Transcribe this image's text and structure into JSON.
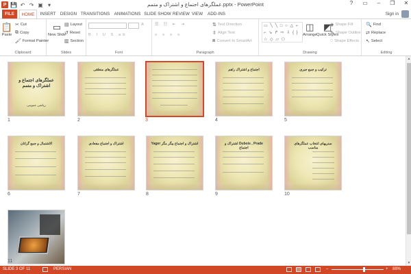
{
  "window": {
    "title": "عملگرهای اجتماع و اشتراک و متمم.pptx - PowerPoint",
    "controls": [
      "?",
      "▭",
      "–",
      "❐",
      "✕"
    ]
  },
  "qat": {
    "logo": "P",
    "save": "💾",
    "undo": "↶",
    "redo": "↷",
    "present": "▣",
    "customize": "▾"
  },
  "tabs": {
    "file": "FILE",
    "items": [
      {
        "label": "HOME",
        "active": true
      },
      {
        "label": "INSERT"
      },
      {
        "label": "DESIGN"
      },
      {
        "label": "TRANSITIONS"
      },
      {
        "label": "ANIMATIONS"
      },
      {
        "label": "SLIDE SHOW"
      },
      {
        "label": "REVIEW"
      },
      {
        "label": "VIEW"
      },
      {
        "label": "ADD-INS"
      }
    ],
    "signin": "Sign in"
  },
  "ribbon": {
    "clipboard": {
      "label": "Clipboard",
      "paste": "Paste",
      "cut": "Cut",
      "copy": "Copy",
      "format_painter": "Format Painter"
    },
    "slides": {
      "label": "Slides",
      "new_slide": "New Slide",
      "layout": "Layout",
      "reset": "Reset",
      "section": "Section"
    },
    "font": {
      "label": "Font"
    },
    "paragraph": {
      "label": "Paragraph",
      "text_direction": "Text Direction",
      "align_text": "Align Text",
      "convert": "Convert to SmartArt"
    },
    "drawing": {
      "label": "Drawing",
      "arrange": "Arrange",
      "quick_styles": "Quick Styles",
      "shape_fill": "Shape Fill",
      "shape_outline": "Shape Outline",
      "shape_effects": "Shape Effects",
      "shapes_glyphs": "▭ ╲ ╲ □ ○ △ ⌐ ⌐ ↘ ↱ ⇨ ⇩ { } ☆ ◇ ▱ ⬠"
    },
    "editing": {
      "label": "Editing",
      "find": "Find",
      "replace": "Replace",
      "select": "Select"
    }
  },
  "slides": [
    {
      "number": "1",
      "title": "عملگرهای اجتماع و اشتراک و متمم",
      "subtitle": "ریاضی عمومی"
    },
    {
      "number": "2",
      "title": "عملگرهای منطقی"
    },
    {
      "number": "3",
      "title": "",
      "selected": true
    },
    {
      "number": "4",
      "title": "اجتماع و اشتراک راهم"
    },
    {
      "number": "5",
      "title": "ترکیب و جمع جبری"
    },
    {
      "number": "6",
      "title": "الاشتمال و جمع گرانان"
    },
    {
      "number": "7",
      "title": "اشتراک و اجتماع مفعادی"
    },
    {
      "number": "8",
      "title": "اشتراک و اجتماع بیگر مگر Yager"
    },
    {
      "number": "9",
      "title": "Dubois , Prade اشتراک و اجتماع"
    },
    {
      "number": "10",
      "title": "سنریهای انتخاب عملگرهای مناسب"
    },
    {
      "number": "11",
      "title": "",
      "photo": true
    }
  ],
  "status": {
    "slide": "SLIDE 3 OF 11",
    "language": "PERSIAN",
    "zoom": "88%",
    "zoom_fraction": 0.62
  }
}
